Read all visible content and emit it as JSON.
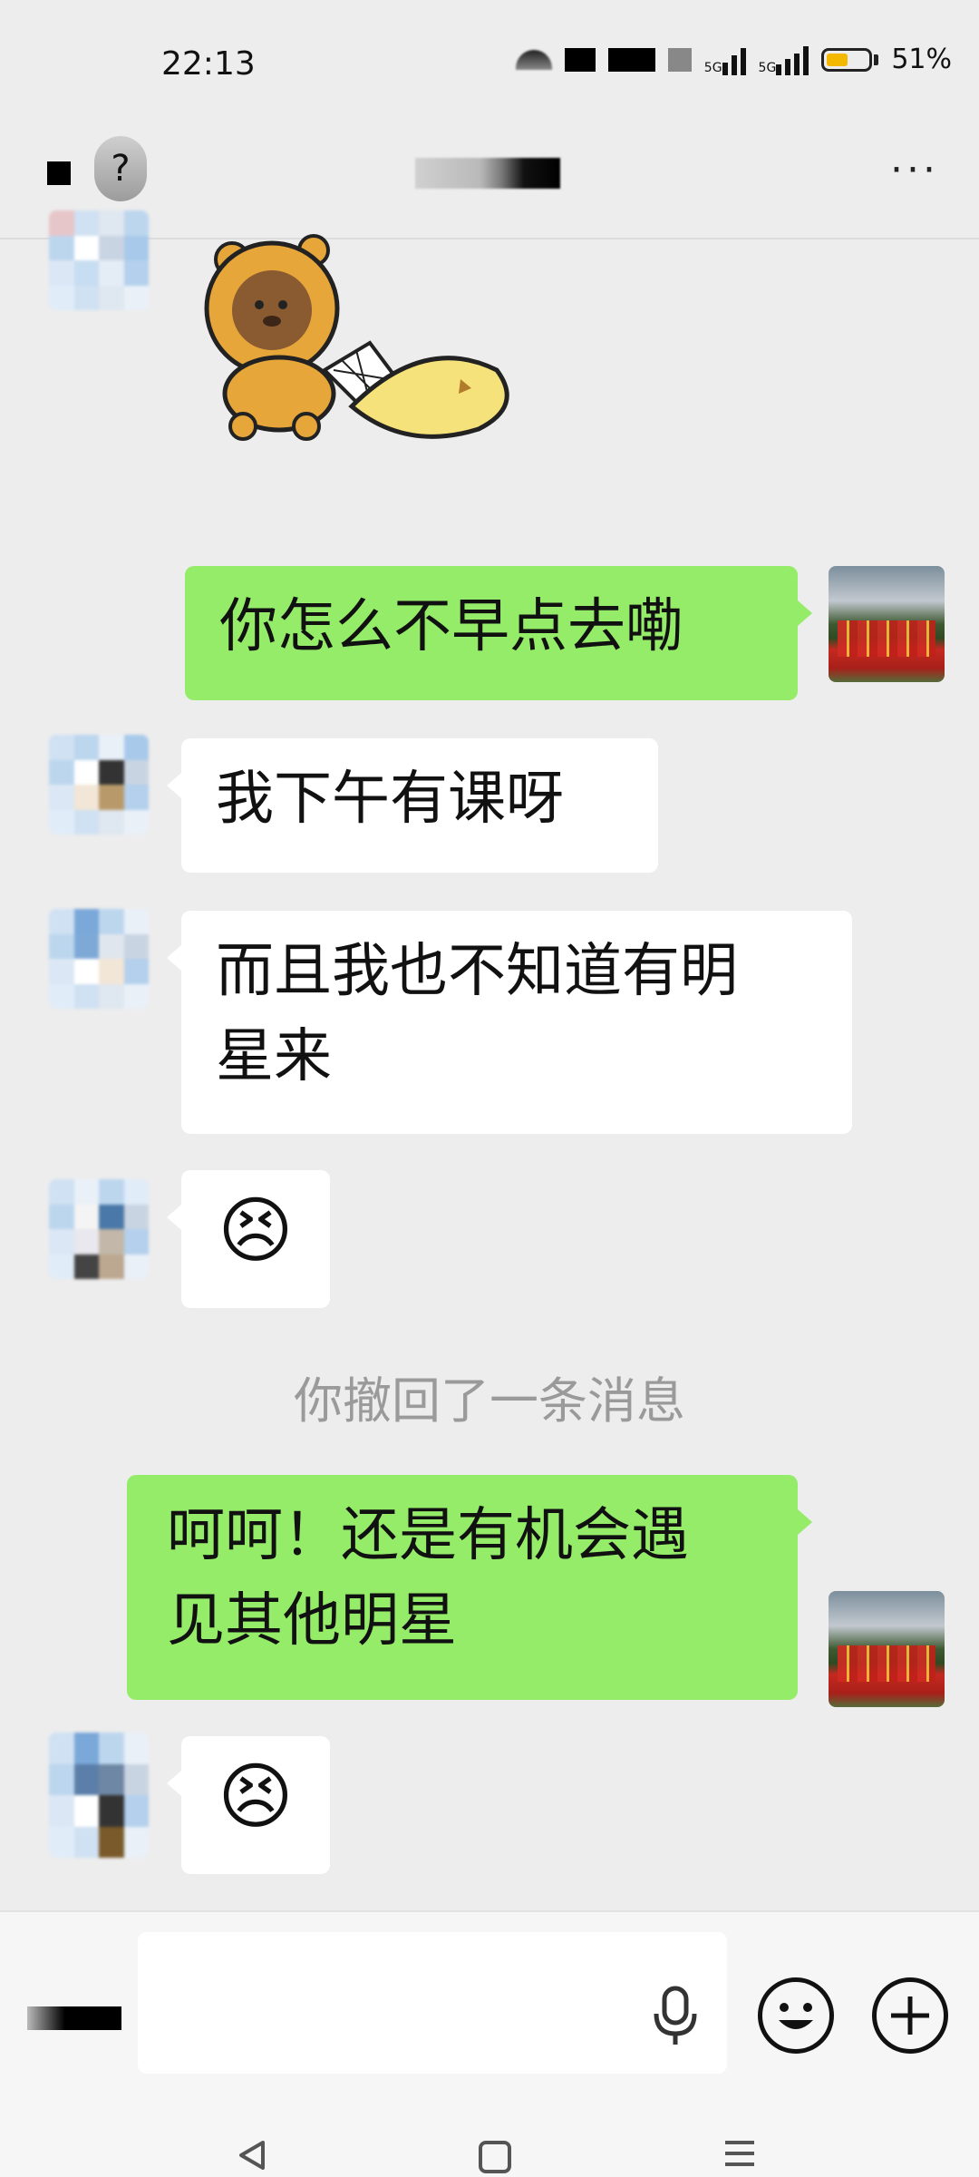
{
  "status_bar": {
    "time": "22:13",
    "network_1": "5G",
    "network_2": "5G",
    "battery_percent": "51%",
    "battery_level": 0.51
  },
  "header": {
    "more_label": "···"
  },
  "messages": [
    {
      "side": "left",
      "type": "sticker",
      "description_icon": "hamster-bear-sticker"
    },
    {
      "side": "right",
      "type": "text",
      "text": "你怎么不早点去嘞"
    },
    {
      "side": "left",
      "type": "text",
      "text": "我下午有课呀"
    },
    {
      "side": "left",
      "type": "text",
      "line1": "而且我也不知道有明",
      "line2": "星来"
    },
    {
      "side": "left",
      "type": "emoji",
      "text": "😣"
    },
    {
      "side": "system",
      "type": "notice",
      "text": "你撤回了一条消息"
    },
    {
      "side": "right",
      "type": "text",
      "line1": "呵呵！还是有机会遇",
      "line2": "见其他明星"
    },
    {
      "side": "left",
      "type": "emoji",
      "text": "😣"
    }
  ],
  "input_bar": {
    "mic_icon": "microphone-icon",
    "emoji_icon": "smiley-face-icon",
    "plus_icon": "plus-icon"
  },
  "nav_bar": {
    "back_icon": "triangle-back-icon",
    "home_icon": "square-home-icon",
    "menu_icon": "menu-lines-icon"
  },
  "colors": {
    "chat_bg": "#ededed",
    "my_bubble": "#95ec69",
    "their_bubble": "#ffffff",
    "battery_fill": "#f5b800"
  }
}
